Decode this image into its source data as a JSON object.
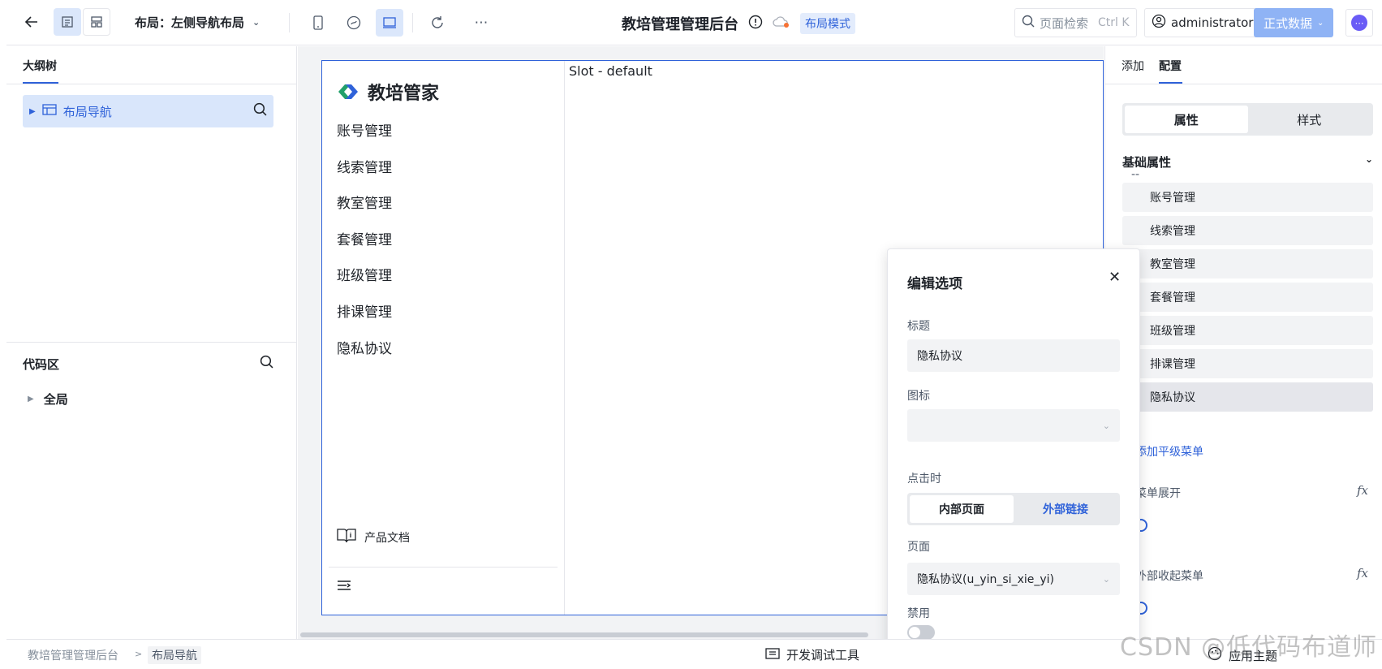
{
  "topbar": {
    "layout_label": "布局：左侧导航布局",
    "app_title": "教培管理管理后台",
    "mode_tag": "布局模式",
    "search_label": "页面检索",
    "search_shortcut": "Ctrl K",
    "user_name": "administrator",
    "data_button": "正式数据",
    "icons": [
      "back-arrow-icon",
      "outline-icon",
      "layout-icon",
      "chevron-down-icon",
      "mobile-icon",
      "mini-program-icon",
      "desktop-icon",
      "refresh-icon",
      "more-icon",
      "info-icon",
      "cloud-icon",
      "search-icon",
      "user-icon",
      "ai-assistant-icon"
    ]
  },
  "left_panel": {
    "outline_tab": "大纲树",
    "tree_node": "布局导航",
    "code_area_title": "代码区",
    "global_node": "全局"
  },
  "canvas": {
    "logo_text": "教培管家",
    "menu": [
      "账号管理",
      "线索管理",
      "教室管理",
      "套餐管理",
      "班级管理",
      "排课管理",
      "隐私协议"
    ],
    "doc_link": "产品文档",
    "slot_label": "Slot - default"
  },
  "right_panel": {
    "tabs": [
      "添加",
      "配置"
    ],
    "active_tab": "配置",
    "segments": [
      "属性",
      "样式"
    ],
    "active_segment": "属性",
    "section_title": "基础属性",
    "options": [
      "账号管理",
      "线索管理",
      "教室管理",
      "套餐管理",
      "班级管理",
      "排课管理",
      "隐私协议"
    ],
    "add_link": "添加平级菜单",
    "prop1_label": "菜单展开",
    "prop2_label": "外部收起菜单",
    "fx_label": "fx"
  },
  "popup": {
    "title": "编辑选项",
    "title_label": "标题",
    "title_value": "隐私协议",
    "icon_label": "图标",
    "click_label": "点击时",
    "click_options": [
      "内部页面",
      "外部链接"
    ],
    "click_selected": "内部页面",
    "page_label": "页面",
    "page_value": "隐私协议(u_yin_si_xie_yi)",
    "disabled_label": "禁用",
    "disabled": false
  },
  "bottombar": {
    "breadcrumb": [
      "教培管理管理后台",
      "布局导航"
    ],
    "devtools": "开发调试工具",
    "theme": "应用主题"
  },
  "watermark": "CSDN @低代码布道师",
  "colors": {
    "accent": "#2f62d9",
    "accent_bg": "#dbe7fb",
    "data_button": "#8fb3f5"
  }
}
